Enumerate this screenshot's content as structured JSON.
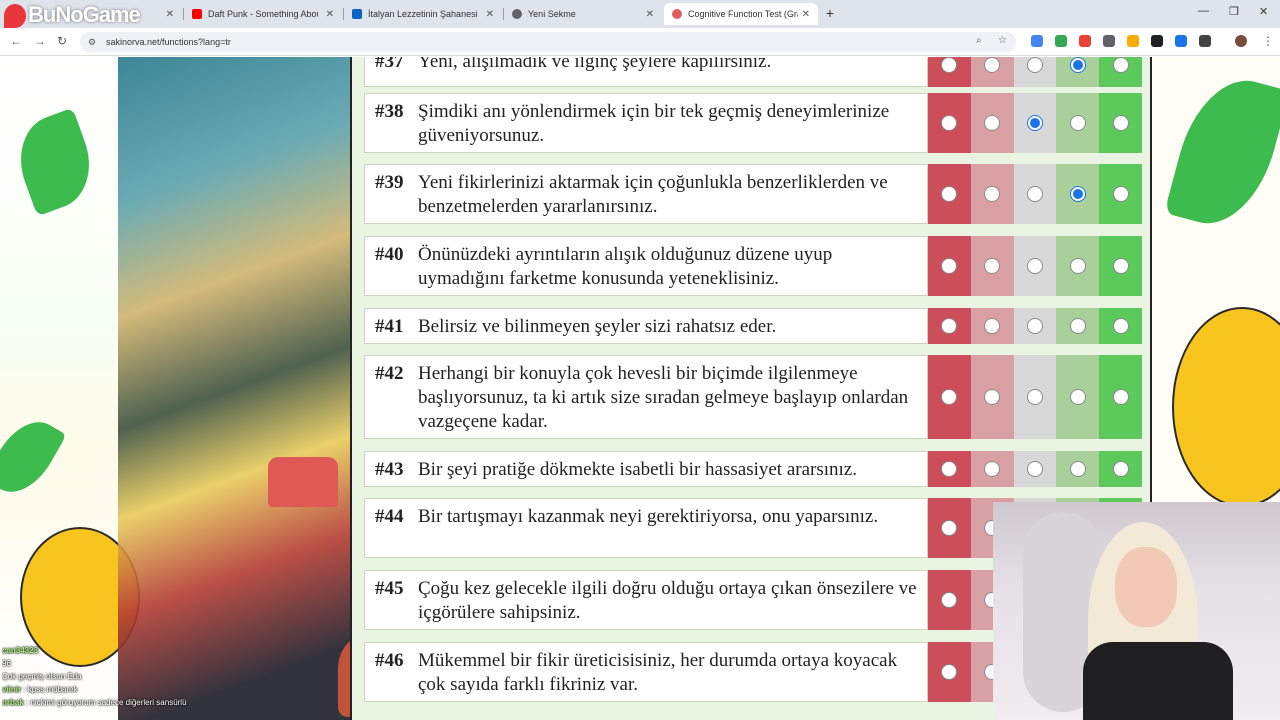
{
  "colors": {
    "accent": "#1a73e8",
    "scale": [
      "#cd4e5b",
      "#d9a0a4",
      "#d8d8d8",
      "#a9cf9a",
      "#5cc95b"
    ]
  },
  "overlay_logo": "BuNoGame",
  "tabs": [
    {
      "label": "",
      "favicon_color": "#ff0000"
    },
    {
      "label": "Daft Punk - Something About U",
      "favicon_color": "#ff0000"
    },
    {
      "label": "İtalyan Lezzetinin Şahanesi Tira",
      "favicon_color": "#0a66c2"
    },
    {
      "label": "Yeni Sekme",
      "favicon_color": "#5f6368"
    },
    {
      "label": "Cognitive Function Test (Grant/",
      "favicon_color": "#e25c5c",
      "active": true
    }
  ],
  "address": {
    "url": "sakinorva.net/functions?lang=tr"
  },
  "questions": [
    {
      "num": "#37",
      "text": "Yeni, alışılmadık ve ilginç şeylere kapılırsınız.",
      "selected": 4
    },
    {
      "num": "#38",
      "text": "Şimdiki anı yönlendirmek için bir tek geçmiş deneyimlerinize güveniyorsunuz.",
      "selected": 3
    },
    {
      "num": "#39",
      "text": "Yeni fikirlerinizi aktarmak için çoğunlukla benzerliklerden ve benzetmelerden yararlanırsınız.",
      "selected": 4
    },
    {
      "num": "#40",
      "text": "Önünüzdeki ayrıntıların alışık olduğunuz düzene uyup uymadığını farketme konusunda yeteneklisiniz.",
      "selected": 0
    },
    {
      "num": "#41",
      "text": "Belirsiz ve bilinmeyen şeyler sizi rahatsız eder.",
      "selected": 0
    },
    {
      "num": "#42",
      "text": "Herhangi bir konuyla çok hevesli bir biçimde ilgilenmeye başlıyorsunuz, ta ki artık size sıradan gelmeye başlayıp onlardan vazgeçene kadar.",
      "selected": 0
    },
    {
      "num": "#43",
      "text": "Bir şeyi pratiğe dökmekte isabetli bir hassasiyet ararsınız.",
      "selected": 0
    },
    {
      "num": "#44",
      "text": "Bir tartışmayı kazanmak neyi gerektiriyorsa, onu yaparsınız.",
      "selected": 0
    },
    {
      "num": "#45",
      "text": "Çoğu kez gelecekle ilgili doğru olduğu ortaya çıkan önsezilere ve içgörülere sahipsiniz.",
      "selected": 0
    },
    {
      "num": "#46",
      "text": "Mükemmel bir fikir üreticisisiniz, her durumda ortaya koyacak çok sayıda farklı fikriniz var.",
      "selected": 0
    }
  ],
  "chat": [
    {
      "user": "can34323",
      "msg": ""
    },
    {
      "user": "",
      "msg": "96"
    },
    {
      "user": "",
      "msg": "Çok geçmiş olsun Eda"
    },
    {
      "user": "viinir",
      "msg": "kpss mübarek"
    },
    {
      "user": "nrbak",
      "msg": "nickimi göruyorum sadece diğerleri sansürlü"
    }
  ]
}
